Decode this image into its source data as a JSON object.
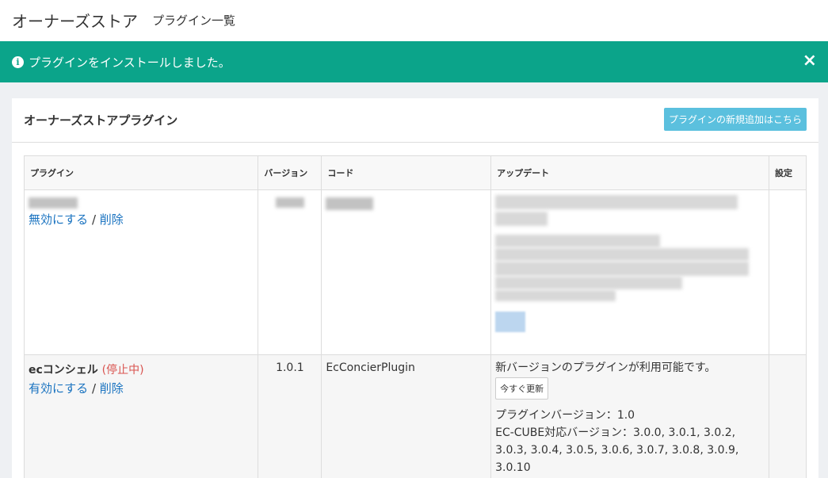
{
  "header": {
    "title": "オーナーズストア",
    "subtitle": "プラグイン一覧"
  },
  "alert": {
    "icon": "info-icon",
    "message": "プラグインをインストールしました。",
    "close_label": "×",
    "color": "#0ba48a"
  },
  "card": {
    "title": "オーナーズストアプラグイン",
    "new_plugin_button": "プラグインの新規追加はこちら",
    "button_color": "#5bc0de"
  },
  "table": {
    "columns": [
      "プラグイン",
      "バージョン",
      "コード",
      "アップデート",
      "設定"
    ],
    "rows": [
      {
        "name": "Coupon",
        "status": "",
        "primary_action": "無効にする",
        "separator": "/",
        "delete_action": "削除",
        "version": "1.0.0",
        "code": "Coupon",
        "update": "blurred"
      },
      {
        "name": "ecコンシェル",
        "status": "(停止中)",
        "primary_action": "有効にする",
        "separator": "/",
        "delete_action": "削除",
        "version": "1.0.1",
        "code": "EcConcierPlugin",
        "update_message": "新バージョンのプラグインが利用可能です。",
        "update_button": "今すぐ更新",
        "plugin_version": "プラグインバージョン：1.0",
        "eccube_versions_line1": "EC-CUBE対応バージョン：3.0.0, 3.0.1, 3.0.2,",
        "eccube_versions_line2": "3.0.3, 3.0.4, 3.0.5, 3.0.6, 3.0.7, 3.0.8, 3.0.9,",
        "eccube_versions_line3": "3.0.10"
      }
    ]
  }
}
